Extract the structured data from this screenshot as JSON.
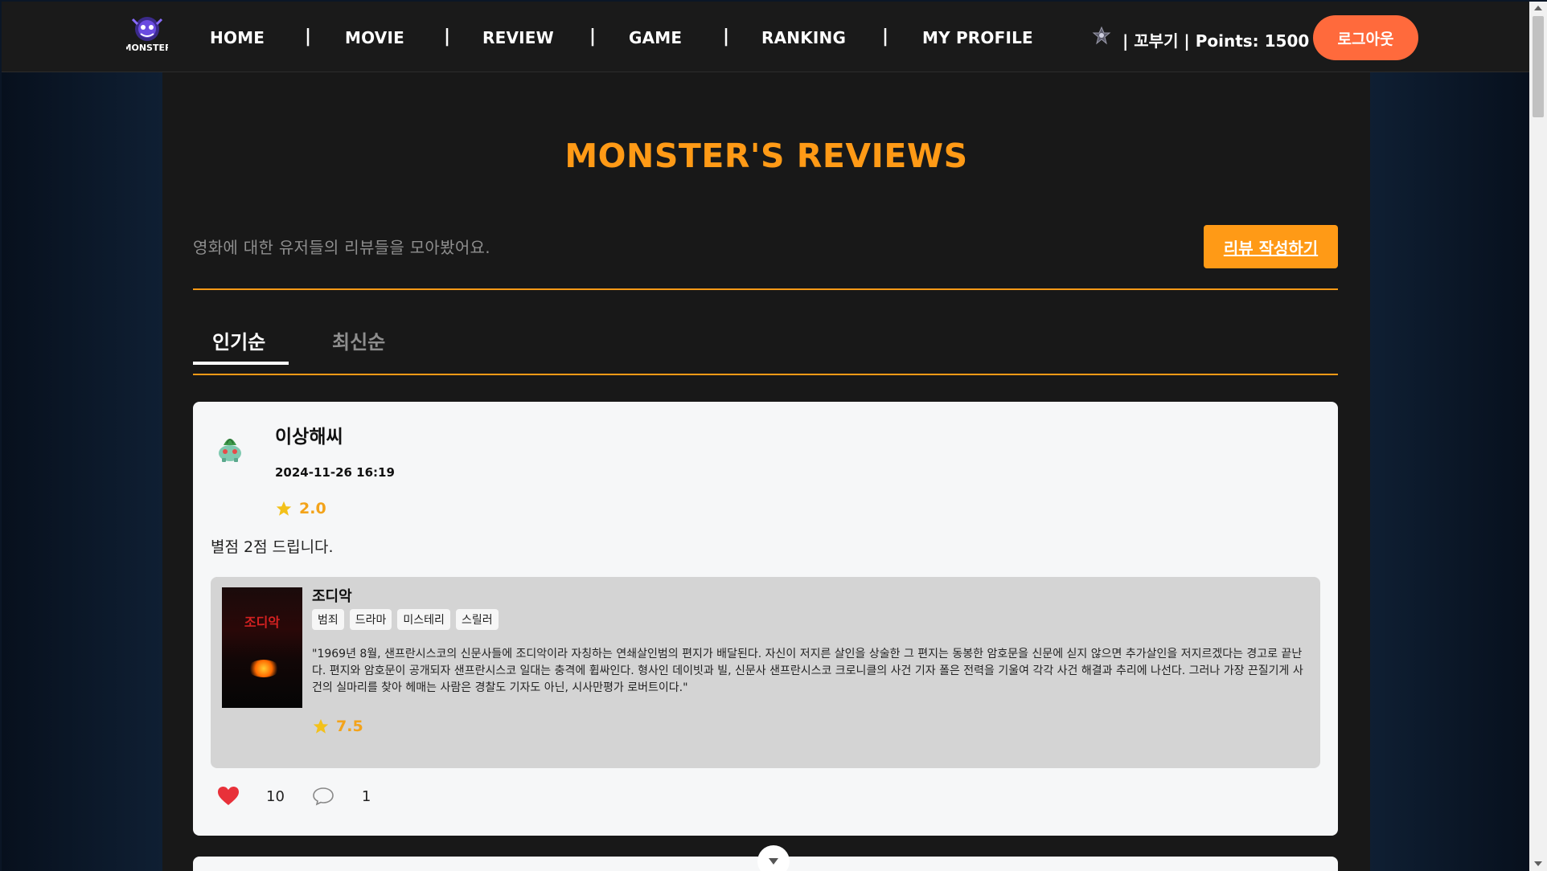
{
  "nav": {
    "items": [
      {
        "label": "HOME"
      },
      {
        "label": "MOVIE"
      },
      {
        "label": "REVIEW"
      },
      {
        "label": "GAME"
      },
      {
        "label": "RANKING"
      },
      {
        "label": "MY PROFILE"
      }
    ],
    "separator": "|",
    "logo_text": "MONSTER",
    "user_info": "| 꼬부기 | Points: 1500",
    "logout_label": "로그아웃"
  },
  "page": {
    "title": "MONSTER'S REVIEWS",
    "subtitle": "영화에 대한 유저들의 리뷰들을 모아봤어요.",
    "write_button": "리뷰 작성하기",
    "tabs": [
      {
        "label": "인기순",
        "active": true
      },
      {
        "label": "최신순",
        "active": false
      }
    ]
  },
  "review": {
    "author": "이상해씨",
    "date": "2024-11-26 16:19",
    "rating": "2.0",
    "text": "별점 2점 드립니다.",
    "movie": {
      "title": "조디악",
      "poster_title": "조디악",
      "genres": [
        "범죄",
        "드라마",
        "미스테리",
        "스릴러"
      ],
      "description": "\"1969년 8월, 샌프란시스코의 신문사들에 조디악이라 자칭하는 연쇄살인범의 편지가 배달된다. 자신이 저지른 살인을 상술한 그 편지는 동봉한 암호문을 신문에 싣지 않으면 추가살인을 저지르겠다는 경고로 끝난다. 편지와 암호문이 공개되자 샌프란시스코 일대는 충격에 휩싸인다. 형사인 데이빗과 빌, 신문사 샌프란시스코 크로니클의 사건 기자 폴은 전력을 기울여 각각 사건 해결과 추리에 나선다. 그러나 가장 끈질기게 사건의 실마리를 찾아 헤매는 사람은 경찰도 기자도 아닌, 시사만평가 로버트이다.\"",
      "rating": "7.5"
    },
    "likes": "10",
    "comments": "1"
  },
  "colors": {
    "accent": "#ff9a16",
    "logout": "#ff6a3c",
    "star": "#f3a31a",
    "heart": "#e8313a"
  }
}
